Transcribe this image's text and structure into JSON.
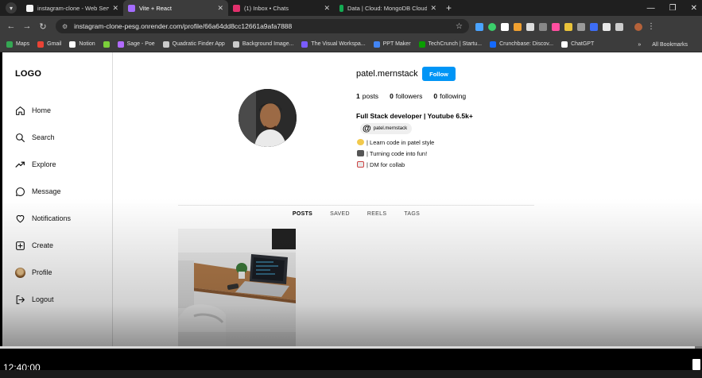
{
  "browser": {
    "tabs": [
      {
        "title": "instagram-clone - Web Service",
        "favicon_color": "#f6f6f6",
        "active": false
      },
      {
        "title": "Vite + React",
        "favicon_color": "#a46cff",
        "active": true
      },
      {
        "title": "(1) Inbox • Chats",
        "favicon_color": "#e1306c",
        "active": false
      },
      {
        "title": "Data | Cloud: MongoDB Cloud",
        "favicon_color": "#13aa52",
        "active": false
      }
    ],
    "url": "instagram-clone-pesg.onrender.com/profile/66a64dd8cc12661a9afa7888",
    "bookmarks": [
      {
        "label": "Maps",
        "color": "#34a853"
      },
      {
        "label": "Gmail",
        "color": "#ea4335"
      },
      {
        "label": "Notion",
        "color": "#ffffff"
      },
      {
        "label": "",
        "color": "#7bcf3a"
      },
      {
        "label": "Sage - Poe",
        "color": "#b26bff"
      },
      {
        "label": "Quadratic Finder App",
        "color": "#cccccc"
      },
      {
        "label": "Background Image...",
        "color": "#cccccc"
      },
      {
        "label": "The Visual Workspa...",
        "color": "#7a5cff"
      },
      {
        "label": "PPT Maker",
        "color": "#4285f4"
      },
      {
        "label": "TechCrunch | Startu...",
        "color": "#0a9e01"
      },
      {
        "label": "Crunchbase: Discov...",
        "color": "#146aff"
      },
      {
        "label": "ChatGPT",
        "color": "#ffffff"
      }
    ],
    "all_bookmarks": "All Bookmarks"
  },
  "sidebar": {
    "logo": "LOGO",
    "items": [
      {
        "label": "Home",
        "icon": "home-icon"
      },
      {
        "label": "Search",
        "icon": "search-icon"
      },
      {
        "label": "Explore",
        "icon": "trending-icon"
      },
      {
        "label": "Message",
        "icon": "message-icon"
      },
      {
        "label": "Notifications",
        "icon": "heart-icon"
      },
      {
        "label": "Create",
        "icon": "plus-square-icon"
      },
      {
        "label": "Profile",
        "icon": "avatar"
      },
      {
        "label": "Logout",
        "icon": "logout-icon"
      }
    ]
  },
  "profile": {
    "username": "patel.mernstack",
    "follow_label": "Follow",
    "posts_count": "1",
    "posts_label": "posts",
    "followers_count": "0",
    "followers_label": "followers",
    "following_count": "0",
    "following_label": "following",
    "bio_title": "Full Stack developer | Youtube 6.5k+",
    "threads_handle": "patel.mernstack",
    "bio_lines": [
      {
        "text": "| Learn code in patel style",
        "emoji_color": "#f2c94c"
      },
      {
        "text": "| Turning code into fun!",
        "emoji_color": "#555555"
      },
      {
        "text": "| DM for collab",
        "emoji_color": "#e8e8e8"
      }
    ]
  },
  "profile_tabs": [
    "POSTS",
    "SAVED",
    "REELS",
    "TAGS"
  ],
  "video": {
    "timecode": "12:40:00",
    "progress_fraction": 0.99
  },
  "colors": {
    "follow_button": "#0095f6",
    "browser_dark": "#3c3c3c"
  }
}
